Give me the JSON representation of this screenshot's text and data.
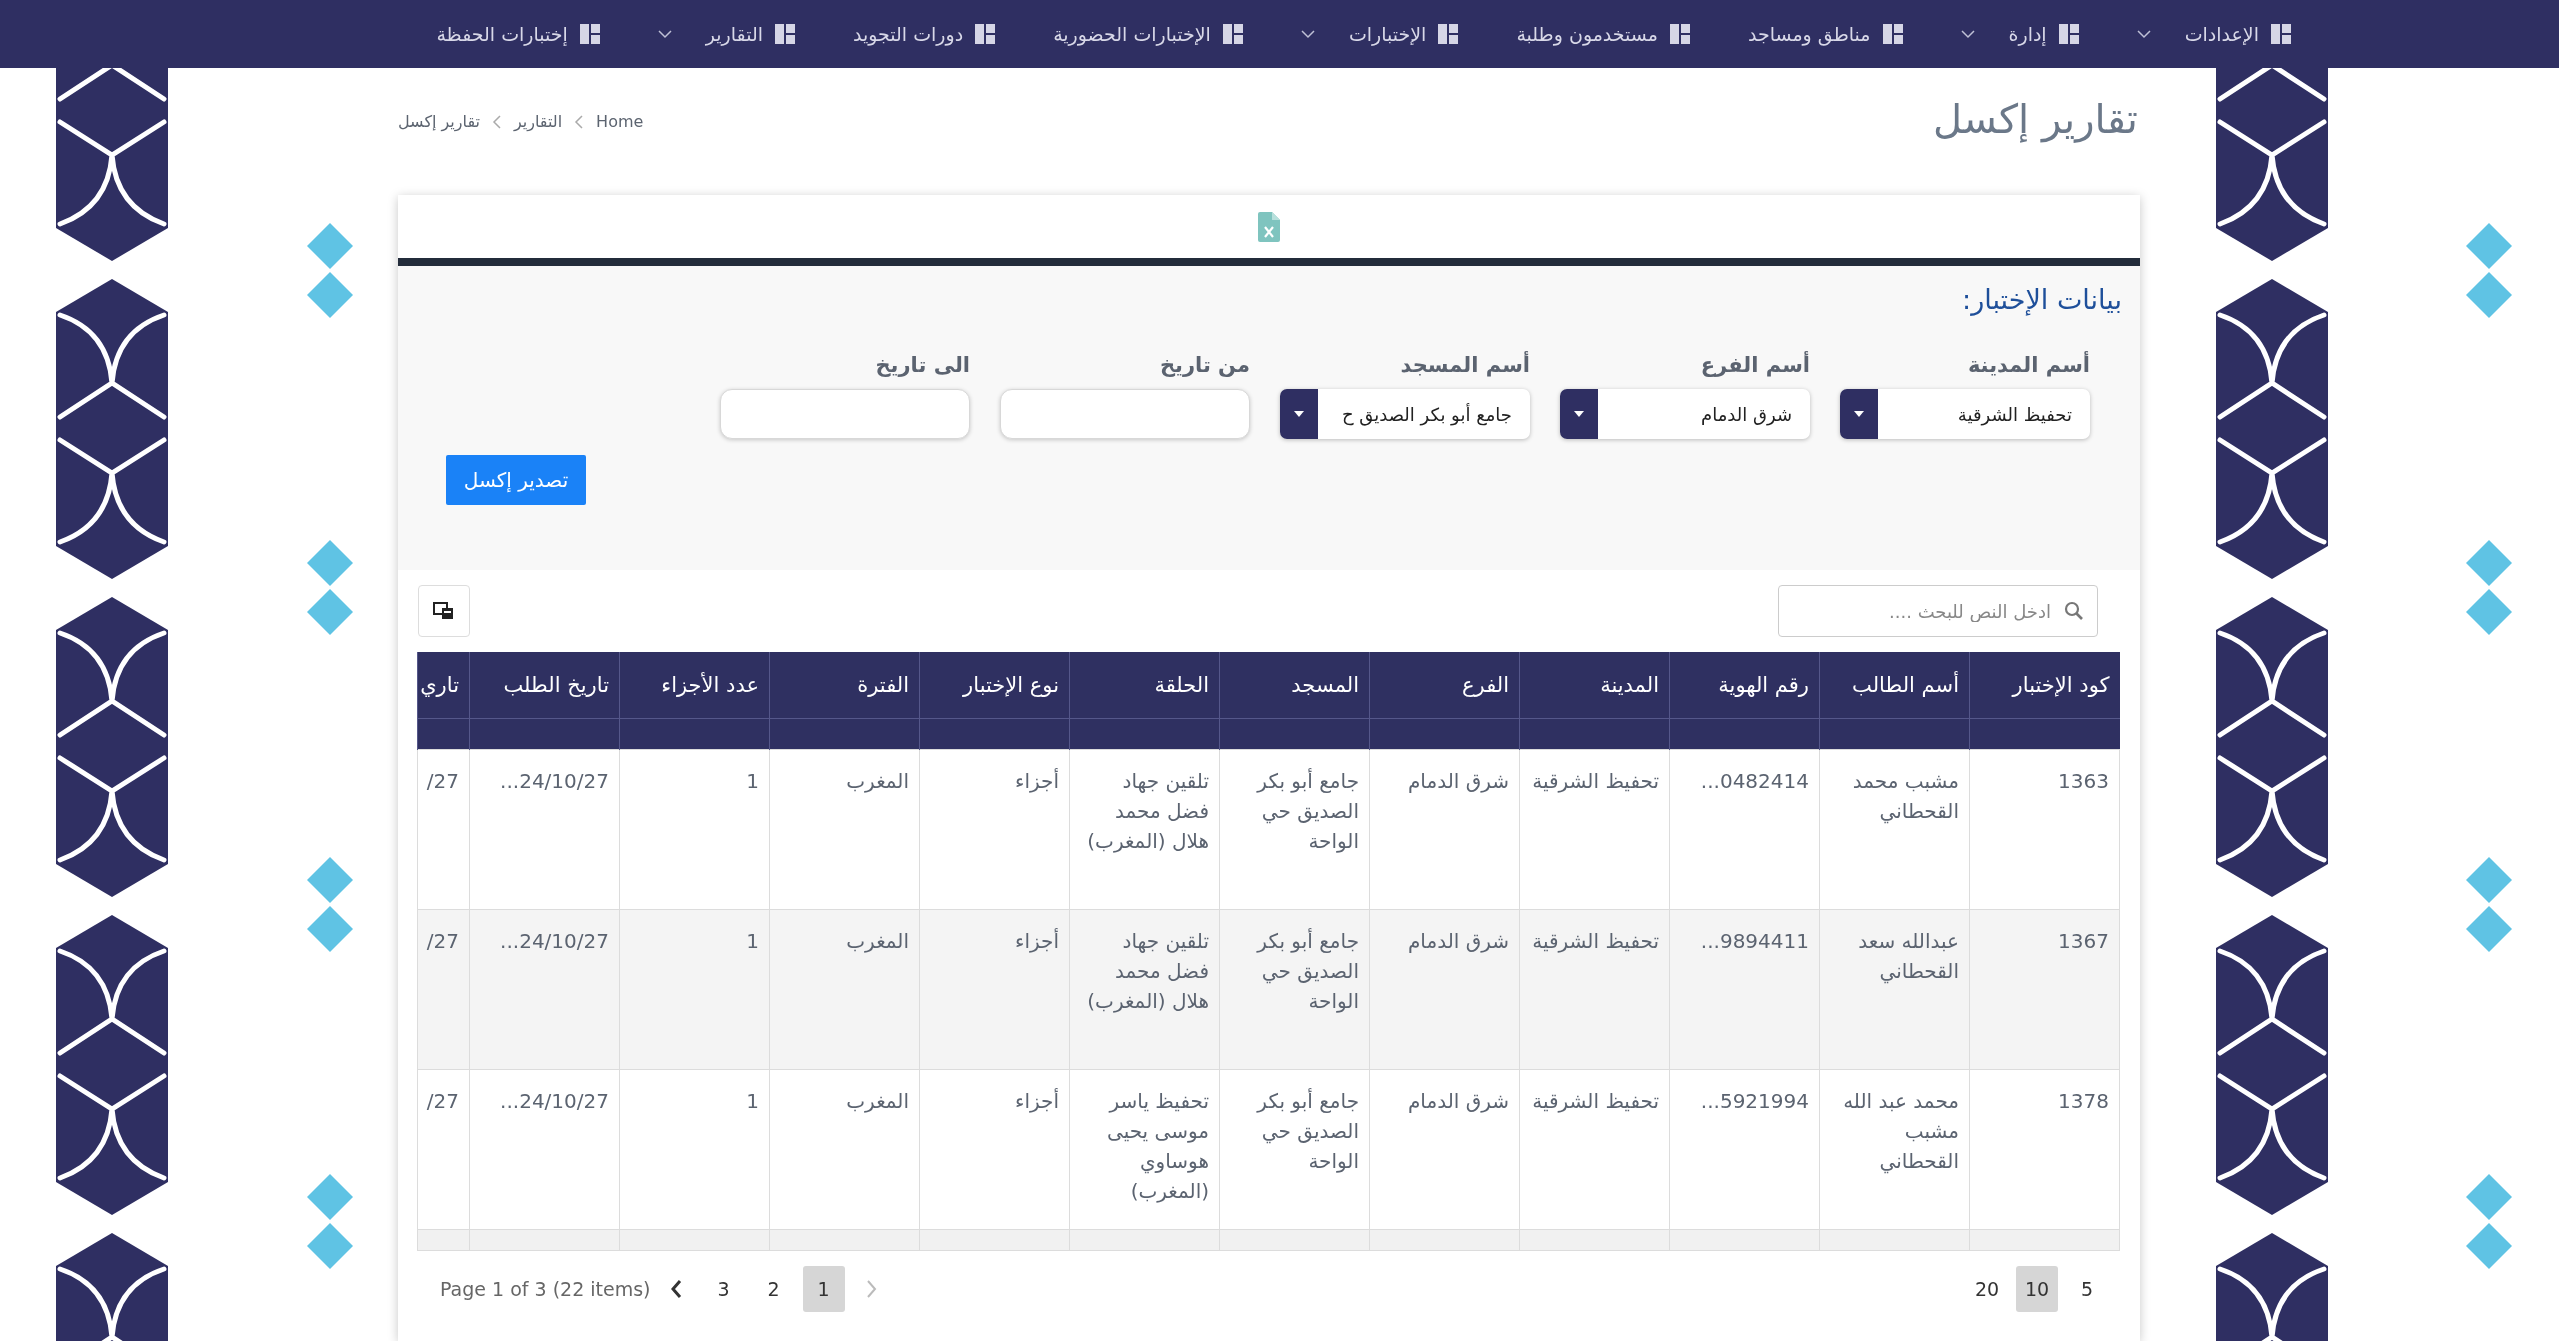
{
  "nav": [
    {
      "label": "الإعدادات",
      "dropdown": true
    },
    {
      "label": "إدارة",
      "dropdown": true
    },
    {
      "label": "مناطق ومساجد",
      "dropdown": false
    },
    {
      "label": "مستخدمون وطلبة",
      "dropdown": false
    },
    {
      "label": "الإختبارات",
      "dropdown": true
    },
    {
      "label": "الإختبارات الحضورية",
      "dropdown": false
    },
    {
      "label": "دورات التجويد",
      "dropdown": false
    },
    {
      "label": "التقارير",
      "dropdown": true
    },
    {
      "label": "إختبارات الحفظة",
      "dropdown": false
    }
  ],
  "page": {
    "title": "تقارير إكسل",
    "breadcrumb": [
      "Home",
      "التقارير",
      "تقارير إكسل"
    ]
  },
  "filter": {
    "heading": "بيانات الإختبار:",
    "fields": [
      {
        "kind": "select",
        "label": "أسم المدينة",
        "value": "تحفيظ الشرقية"
      },
      {
        "kind": "select",
        "label": "أسم الفرع",
        "value": "شرق الدمام"
      },
      {
        "kind": "select",
        "label": "أسم المسجد",
        "value": "جامع أبو بكر الصديق ح"
      },
      {
        "kind": "date",
        "label": "من تاريخ"
      },
      {
        "kind": "date",
        "label": "الى تاريخ"
      }
    ],
    "export_button": "تصدير إكسل"
  },
  "grid": {
    "search": {
      "placeholder": "ادخل النص للبحث ...."
    },
    "columns": [
      "كود الإختبار",
      "أسم الطالب",
      "رقم الهوية",
      "المدينة",
      "الفرع",
      "المسجد",
      "الحلقة",
      "نوع الإختبار",
      "الفترة",
      "عدد الأجزاء",
      "تاريخ الطلب",
      "تاري"
    ],
    "rows": [
      [
        "1363",
        "مشبب محمد القحطاني",
        "...0482414",
        "تحفيظ الشرقية",
        "شرق الدمام",
        "جامع أبو بكر الصديق حي الواحة",
        "تلقين جهاد فضل محمد هلال (المغرب)",
        "أجزاء",
        "المغرب",
        "1",
        "...24/10/27",
        "/27"
      ],
      [
        "1367",
        "عبدالله سعد القحطاني",
        "...9894411",
        "تحفيظ الشرقية",
        "شرق الدمام",
        "جامع أبو بكر الصديق حي الواحة",
        "تلقين جهاد فضل محمد هلال (المغرب)",
        "أجزاء",
        "المغرب",
        "1",
        "...24/10/27",
        "/27"
      ],
      [
        "1378",
        "محمد عبد الله مشبب القحطاني",
        "...5921994",
        "تحفيظ الشرقية",
        "شرق الدمام",
        "جامع أبو بكر الصديق حي الواحة",
        "تحفيظ ياسر موسى يحيى هوساوي (المغرب)",
        "أجزاء",
        "المغرب",
        "1",
        "...24/10/27",
        "/27"
      ]
    ],
    "pager": {
      "page_sizes": [
        {
          "label": "5",
          "selected": false
        },
        {
          "label": "10",
          "selected": true
        },
        {
          "label": "20",
          "selected": false
        }
      ],
      "next": {
        "disabled": true
      },
      "pages": [
        {
          "label": "1",
          "selected": true
        },
        {
          "label": "2",
          "selected": false
        },
        {
          "label": "3",
          "selected": false
        }
      ],
      "prev": {
        "disabled": false
      },
      "info": "Page 1 of 3 (22 items)"
    }
  }
}
